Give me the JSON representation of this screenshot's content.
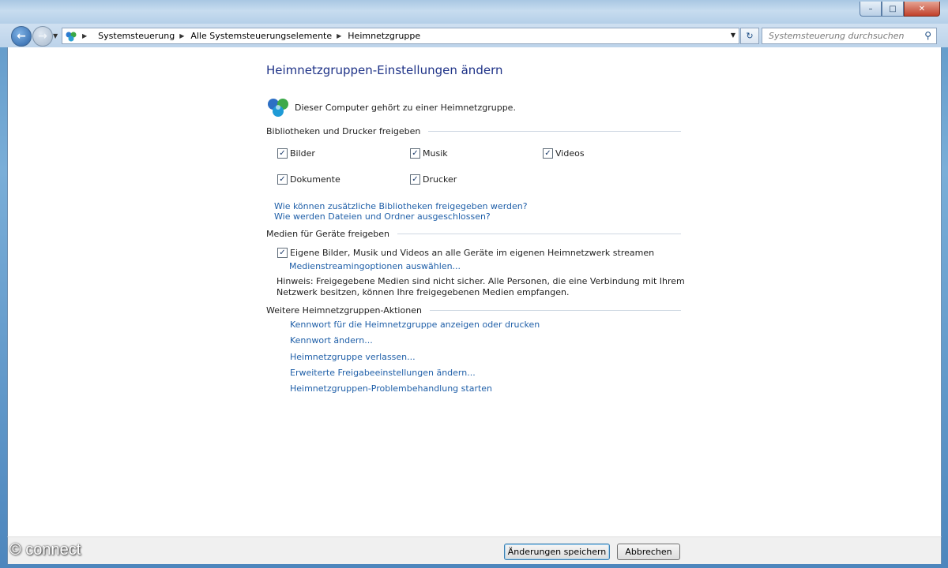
{
  "window": {
    "minimize": "–",
    "maximize": "□",
    "close": "✕"
  },
  "nav": {
    "back_glyph": "←",
    "forward_glyph": "→",
    "breadcrumbs": [
      "Systemsteuerung",
      "Alle Systemsteuerungselemente",
      "Heimnetzgruppe"
    ],
    "refresh_glyph": "↻",
    "search_placeholder": "Systemsteuerung durchsuchen"
  },
  "page": {
    "title": "Heimnetzgruppen-Einstellungen ändern",
    "status": "Dieser Computer gehört zu einer Heimnetzgruppe."
  },
  "libraries": {
    "heading": "Bibliotheken und Drucker freigeben",
    "items": [
      {
        "label": "Bilder",
        "checked": true
      },
      {
        "label": "Musik",
        "checked": true
      },
      {
        "label": "Videos",
        "checked": true
      },
      {
        "label": "Dokumente",
        "checked": true
      },
      {
        "label": "Drucker",
        "checked": true
      }
    ],
    "links": [
      "Wie können zusätzliche Bibliotheken freigegeben werden?",
      "Wie werden Dateien und Ordner ausgeschlossen?"
    ]
  },
  "media": {
    "heading": "Medien für Geräte freigeben",
    "stream_label": "Eigene Bilder, Musik und Videos an alle Geräte im eigenen Heimnetzwerk streamen",
    "stream_checked": true,
    "options_link": "Medienstreamingoptionen auswählen...",
    "hint": "Hinweis: Freigegebene Medien sind nicht sicher. Alle Personen, die eine Verbindung mit Ihrem Netzwerk besitzen, können Ihre freigegebenen Medien empfangen."
  },
  "actions": {
    "heading": "Weitere Heimnetzgruppen-Aktionen",
    "links": [
      "Kennwort für die Heimnetzgruppe anzeigen oder drucken",
      "Kennwort ändern...",
      "Heimnetzgruppe verlassen...",
      "Erweiterte Freigabeeinstellungen ändern...",
      "Heimnetzgruppen-Problembehandlung starten"
    ]
  },
  "buttons": {
    "save": "Änderungen speichern",
    "cancel": "Abbrechen"
  },
  "watermark": "© connect",
  "colors": {
    "link": "#1f5fa8",
    "title": "#1e3287"
  }
}
